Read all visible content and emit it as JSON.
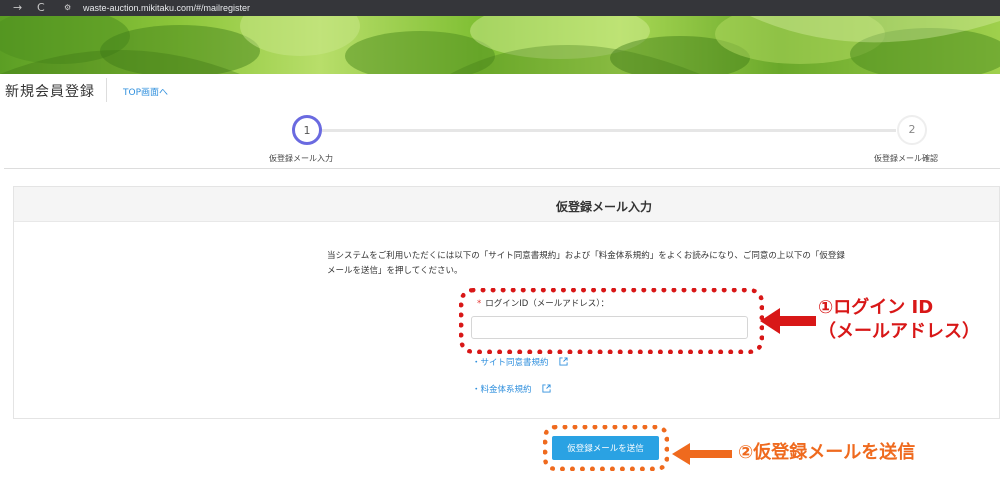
{
  "browser": {
    "url": "waste-auction.mikitaku.com/#/mailregister",
    "forward_icon": "→",
    "reload_icon": "C"
  },
  "header": {
    "title": "新規会員登録",
    "top_link": "TOP画面へ"
  },
  "stepper": {
    "steps": [
      {
        "number": "1",
        "label": "仮登録メール入力",
        "active": true
      },
      {
        "number": "2",
        "label": "仮登録メール確認",
        "active": false
      }
    ]
  },
  "panel": {
    "title": "仮登録メール入力",
    "instruction_line1": "当システムをご利用いただくには以下の「サイト同意書規約」および「料金体系規約」をよくお読みになり、ご同意の上以下の「仮登録",
    "instruction_line2": "メールを送信」を押してください。",
    "required_mark": "*",
    "login_label": "ログインID（メールアドレス）：",
    "login_value": "",
    "links": [
      {
        "label": "・サイト同意書規約"
      },
      {
        "label": "・料金体系規約"
      }
    ],
    "submit_label": "仮登録メールを送信"
  },
  "annotations": {
    "note1_line1": "①ログイン ID",
    "note1_line2": "（メールアドレス）",
    "note2": "②仮登録メールを送信",
    "red": "#d81717",
    "orange": "#ef6a1e"
  },
  "colors": {
    "accent": "#2aa2e3",
    "link": "#2f8fdd",
    "step_active": "#6a6ae0"
  }
}
